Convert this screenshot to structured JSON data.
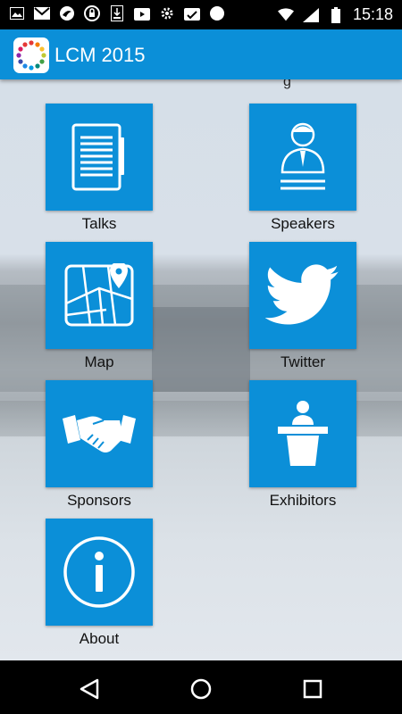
{
  "status_bar": {
    "time": "15:18",
    "left_icons": [
      "image-icon",
      "gmail-icon",
      "bird-app-icon",
      "lock-icon",
      "download-icon",
      "play-store-icon",
      "settings-gear-icon",
      "photos-icon",
      "circle-icon"
    ],
    "right_icons": [
      "wifi-icon",
      "signal-icon",
      "battery-icon"
    ]
  },
  "app_bar": {
    "title": "LCM 2015",
    "accent_color": "#0b8fd8"
  },
  "grid": {
    "cut_label": "g",
    "tiles": [
      {
        "label": "Talks",
        "icon": "document-icon"
      },
      {
        "label": "Speakers",
        "icon": "speaker-icon"
      },
      {
        "label": "Map",
        "icon": "map-icon"
      },
      {
        "label": "Twitter",
        "icon": "twitter-icon"
      },
      {
        "label": "Sponsors",
        "icon": "handshake-icon"
      },
      {
        "label": "Exhibitors",
        "icon": "podium-icon"
      },
      {
        "label": "About",
        "icon": "info-icon"
      }
    ]
  },
  "nav_bar": {
    "buttons": [
      "back-icon",
      "home-icon",
      "recents-icon"
    ]
  }
}
